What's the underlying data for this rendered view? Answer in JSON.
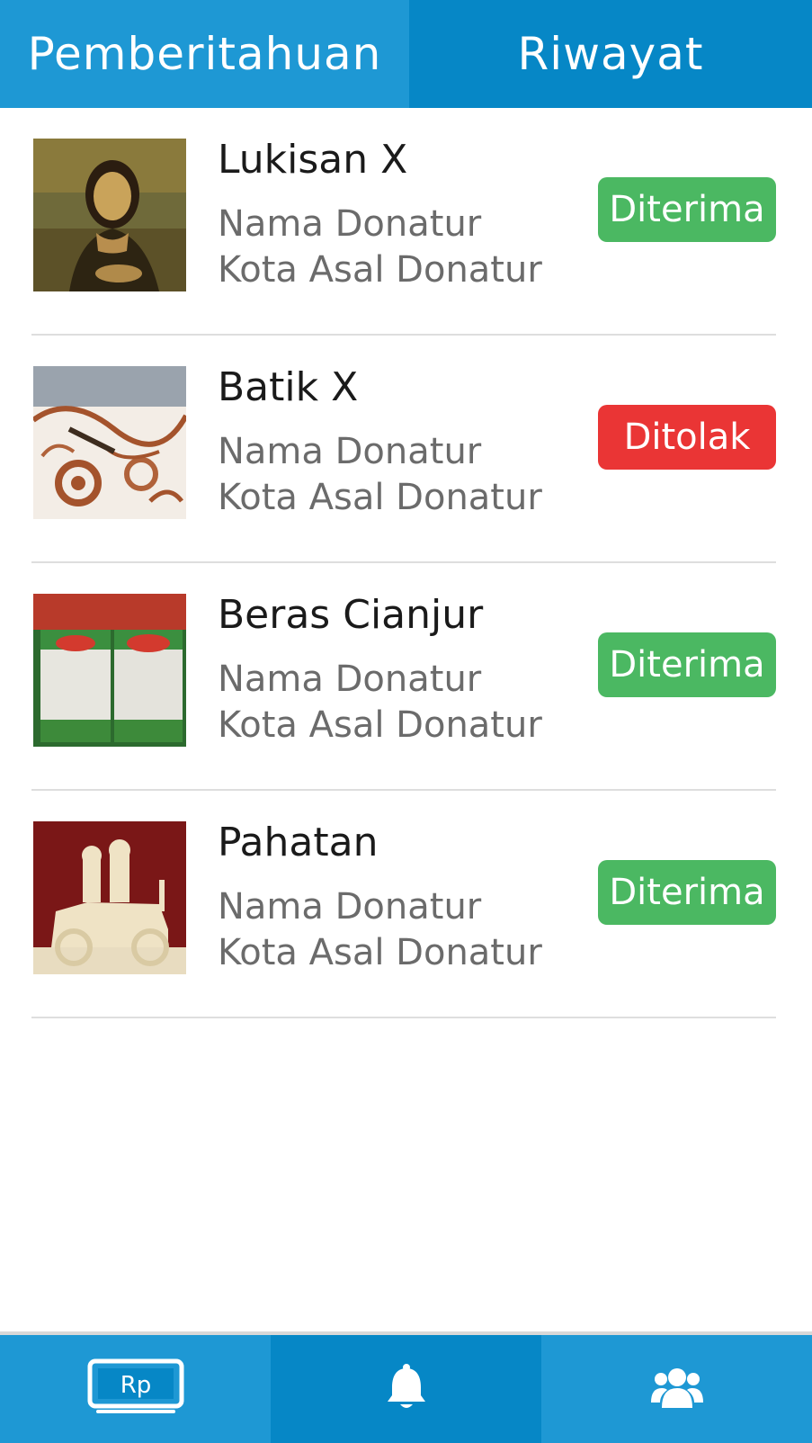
{
  "tabs": {
    "notifications": "Pemberitahuan",
    "history": "Riwayat"
  },
  "items": [
    {
      "title": "Lukisan X",
      "donor_name": "Nama Donatur",
      "donor_city": "Kota Asal Donatur",
      "status": "Diterima",
      "status_color": "#4bb862"
    },
    {
      "title": "Batik X",
      "donor_name": "Nama Donatur",
      "donor_city": "Kota Asal Donatur",
      "status": "Ditolak",
      "status_color": "#ea3535"
    },
    {
      "title": "Beras Cianjur",
      "donor_name": "Nama Donatur",
      "donor_city": "Kota Asal Donatur",
      "status": "Diterima",
      "status_color": "#4bb862"
    },
    {
      "title": "Pahatan",
      "donor_name": "Nama Donatur",
      "donor_city": "Kota Asal Donatur",
      "status": "Diterima",
      "status_color": "#4bb862"
    }
  ],
  "bottom_nav": {
    "donation_icon": "rupiah-screen-icon",
    "donation_icon_text": "Rp",
    "notification_icon": "bell-icon",
    "community_icon": "users-icon"
  },
  "colors": {
    "primary": "#1e98d4",
    "primary_dark": "#0687c6",
    "accepted": "#4bb862",
    "rejected": "#ea3535"
  }
}
